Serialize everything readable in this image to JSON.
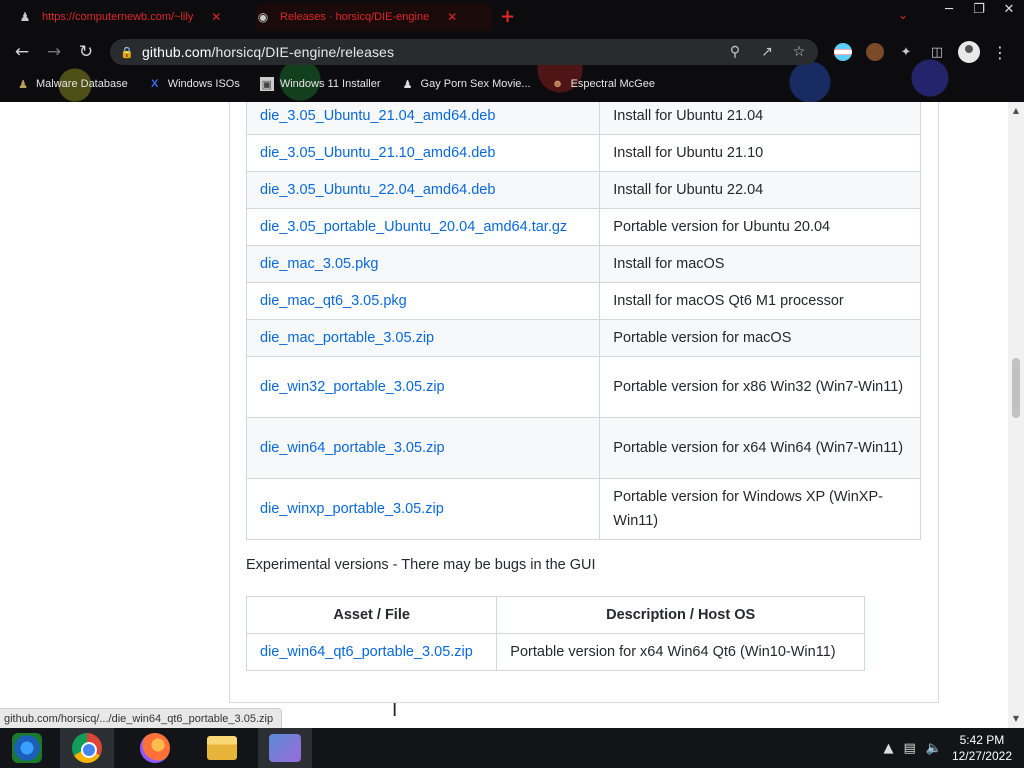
{
  "tabs": [
    {
      "title": "https://computernewb.com/~lily",
      "favicon": "spy-icon"
    },
    {
      "title": "Releases · horsicq/DIE-engine",
      "favicon": "github-icon"
    }
  ],
  "address_bar": {
    "host": "github.com",
    "path": "/horsicq/DIE-engine/releases"
  },
  "bookmarks": [
    {
      "label": "Malware Database",
      "icon": "person-icon"
    },
    {
      "label": "Windows ISOs",
      "icon": "x-icon"
    },
    {
      "label": "Windows 11 Installer",
      "icon": "image-icon"
    },
    {
      "label": "Gay Porn Sex Movie...",
      "icon": "spy-icon"
    },
    {
      "label": "Espectral McGee",
      "icon": "face-icon"
    }
  ],
  "files_table": {
    "rows": [
      {
        "file": "die_3.05_Ubuntu_21.04_amd64.deb",
        "desc": "Install for Ubuntu 21.04"
      },
      {
        "file": "die_3.05_Ubuntu_21.10_amd64.deb",
        "desc": "Install for Ubuntu 21.10"
      },
      {
        "file": "die_3.05_Ubuntu_22.04_amd64.deb",
        "desc": "Install for Ubuntu 22.04"
      },
      {
        "file": "die_3.05_portable_Ubuntu_20.04_amd64.tar.gz",
        "desc": "Portable version for Ubuntu 20.04"
      },
      {
        "file": "die_mac_3.05.pkg",
        "desc": "Install for macOS"
      },
      {
        "file": "die_mac_qt6_3.05.pkg",
        "desc": "Install for macOS Qt6 M1 processor"
      },
      {
        "file": "die_mac_portable_3.05.zip",
        "desc": "Portable version for macOS"
      },
      {
        "file": "die_win32_portable_3.05.zip",
        "desc": "Portable version for x86 Win32 (Win7-Win11)"
      },
      {
        "file": "die_win64_portable_3.05.zip",
        "desc": "Portable version for x64 Win64 (Win7-Win11)"
      },
      {
        "file": "die_winxp_portable_3.05.zip",
        "desc": "Portable version for Windows XP (WinXP-Win11)"
      }
    ]
  },
  "experimental": {
    "note": "Experimental versions - There may be bugs in the GUI",
    "header_asset": "Asset / File",
    "header_desc": "Description / Host OS",
    "rows": [
      {
        "file": "die_win64_qt6_portable_3.05.zip",
        "desc": "Portable version for x64 Win64 Qt6 (Win10-Win11)"
      }
    ]
  },
  "status_bar": "github.com/horsicq/.../die_win64_qt6_portable_3.05.zip",
  "taskbar": {
    "apps": [
      "start-icon",
      "chrome-icon",
      "firefox-icon",
      "file-explorer-icon",
      "people-icon"
    ],
    "time": "5:42 PM",
    "date": "12/27/2022"
  }
}
